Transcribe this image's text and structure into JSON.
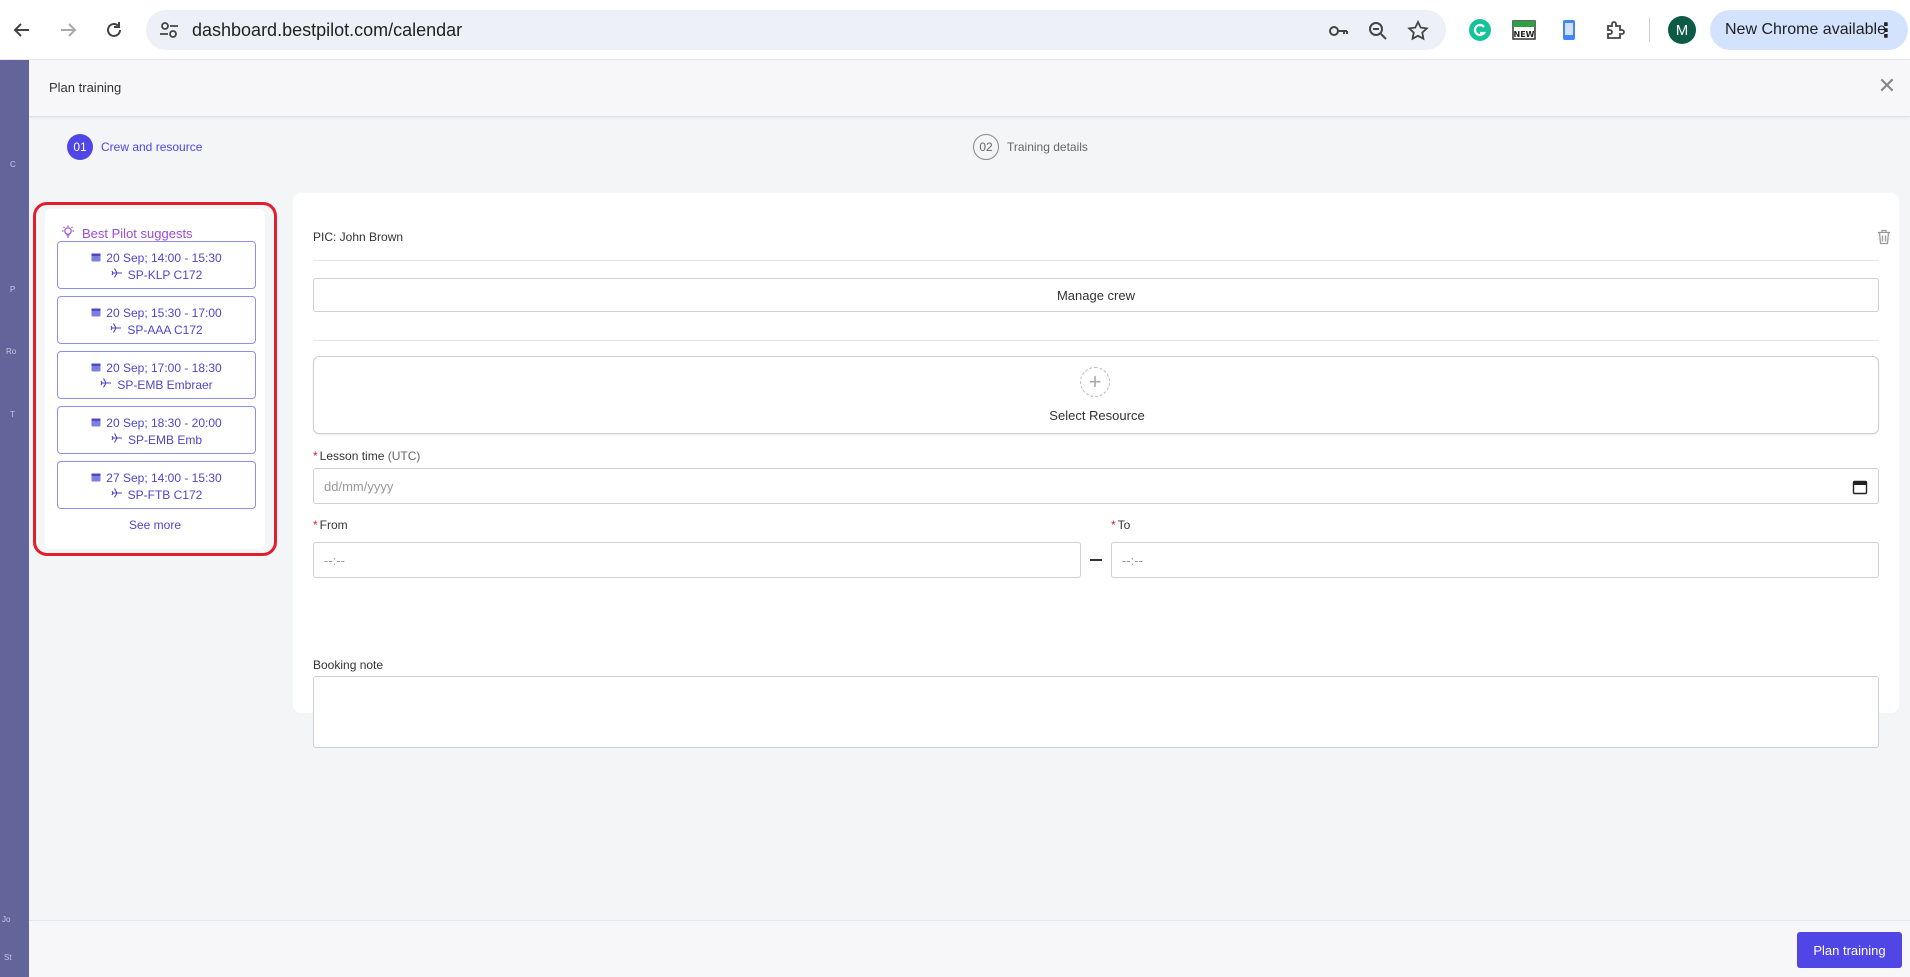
{
  "browser": {
    "url": "dashboard.bestpilot.com/calendar",
    "update_label": "New Chrome available",
    "profile_initial": "M"
  },
  "sidebar": {
    "letters": [
      "C",
      "P",
      "Ro",
      "T",
      "Jo",
      "St"
    ]
  },
  "modal": {
    "title": "Plan training",
    "steps": [
      {
        "num": "01",
        "label": "Crew and resource"
      },
      {
        "num": "02",
        "label": "Training details"
      }
    ]
  },
  "suggestions": {
    "title": "Best Pilot suggests",
    "items": [
      {
        "time": "20 Sep; 14:00 - 15:30",
        "aircraft": "SP-KLP C172"
      },
      {
        "time": "20 Sep; 15:30 - 17:00",
        "aircraft": "SP-AAA C172"
      },
      {
        "time": "20 Sep; 17:00 - 18:30",
        "aircraft": "SP-EMB Embraer"
      },
      {
        "time": "20 Sep; 18:30 - 20:00",
        "aircraft": "SP-EMB Emb"
      },
      {
        "time": "27 Sep; 14:00 - 15:30",
        "aircraft": "SP-FTB C172"
      }
    ],
    "see_more": "See more"
  },
  "form": {
    "pic": "PIC: John Brown",
    "manage_crew": "Manage crew",
    "select_resource": "Select Resource",
    "lesson_time_label": "Lesson time",
    "lesson_time_hint": "(UTC)",
    "date_placeholder": "dd/mm/yyyy",
    "from_label": "From",
    "to_label": "To",
    "time_placeholder": "--:--",
    "booking_note_label": "Booking note",
    "required_mark": "*"
  },
  "footer": {
    "submit": "Plan training"
  },
  "colors": {
    "accent": "#4f46e5",
    "suggest_title": "#9b4bd6",
    "highlight": "#e11d2e"
  }
}
